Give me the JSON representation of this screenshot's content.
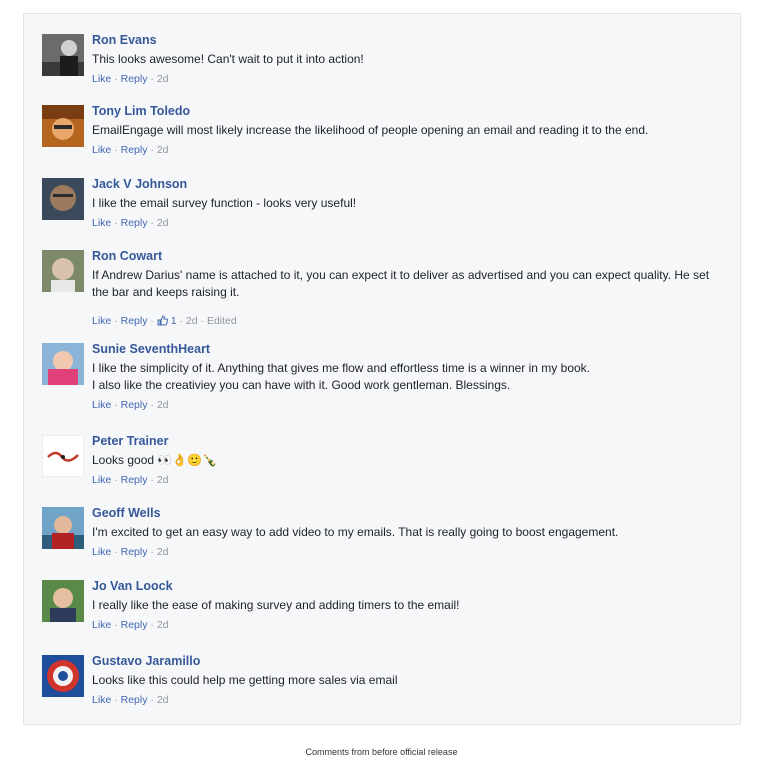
{
  "comments": [
    {
      "author": "Ron Evans",
      "text": [
        "This looks awesome! Can't wait to put it into action!"
      ],
      "like": "Like",
      "reply": "Reply",
      "time": "2d"
    },
    {
      "author": "Tony Lim Toledo",
      "text": [
        "EmailEngage will most likely increase the likelihood of people opening an email and reading it to the end."
      ],
      "like": "Like",
      "reply": "Reply",
      "time": "2d"
    },
    {
      "author": "Jack V Johnson",
      "text": [
        "I like the email survey function - looks very useful!"
      ],
      "like": "Like",
      "reply": "Reply",
      "time": "2d"
    },
    {
      "author": "Ron Cowart",
      "text": [
        "If Andrew Darius' name is attached to it, you can expect it to deliver as advertised and you can expect quality. He set",
        "the bar and keeps raising it."
      ],
      "like": "Like",
      "reply": "Reply",
      "reactions": "1",
      "time": "2d",
      "edited": "Edited"
    },
    {
      "author": "Sunie SeventhHeart",
      "text": [
        "I like the simplicity of it. Anything that gives me flow and effortless time is a winner in my book.",
        "I also like the creativiey you can have with it. Good work gentleman. Blessings."
      ],
      "like": "Like",
      "reply": "Reply",
      "time": "2d"
    },
    {
      "author": "Peter Trainer",
      "text": [
        "Looks good"
      ],
      "emojis": "👀👌🙂🍾",
      "like": "Like",
      "reply": "Reply",
      "time": "2d"
    },
    {
      "author": "Geoff Wells",
      "text": [
        "I'm excited to get an easy way to add video to my emails. That is really going to boost engagement."
      ],
      "like": "Like",
      "reply": "Reply",
      "time": "2d"
    },
    {
      "author": "Jo Van Loock",
      "text": [
        "I really like the ease of making survey and adding timers to the email!"
      ],
      "like": "Like",
      "reply": "Reply",
      "time": "2d"
    },
    {
      "author": "Gustavo Jaramillo",
      "text": [
        "Looks like this could help me getting more sales via email"
      ],
      "like": "Like",
      "reply": "Reply",
      "time": "2d"
    }
  ],
  "separator": "·",
  "caption": "Comments from before official release",
  "colors": {
    "author": "#365899",
    "link": "#4267b2",
    "panel": "#f6f7f9",
    "meta": "#90949c"
  }
}
